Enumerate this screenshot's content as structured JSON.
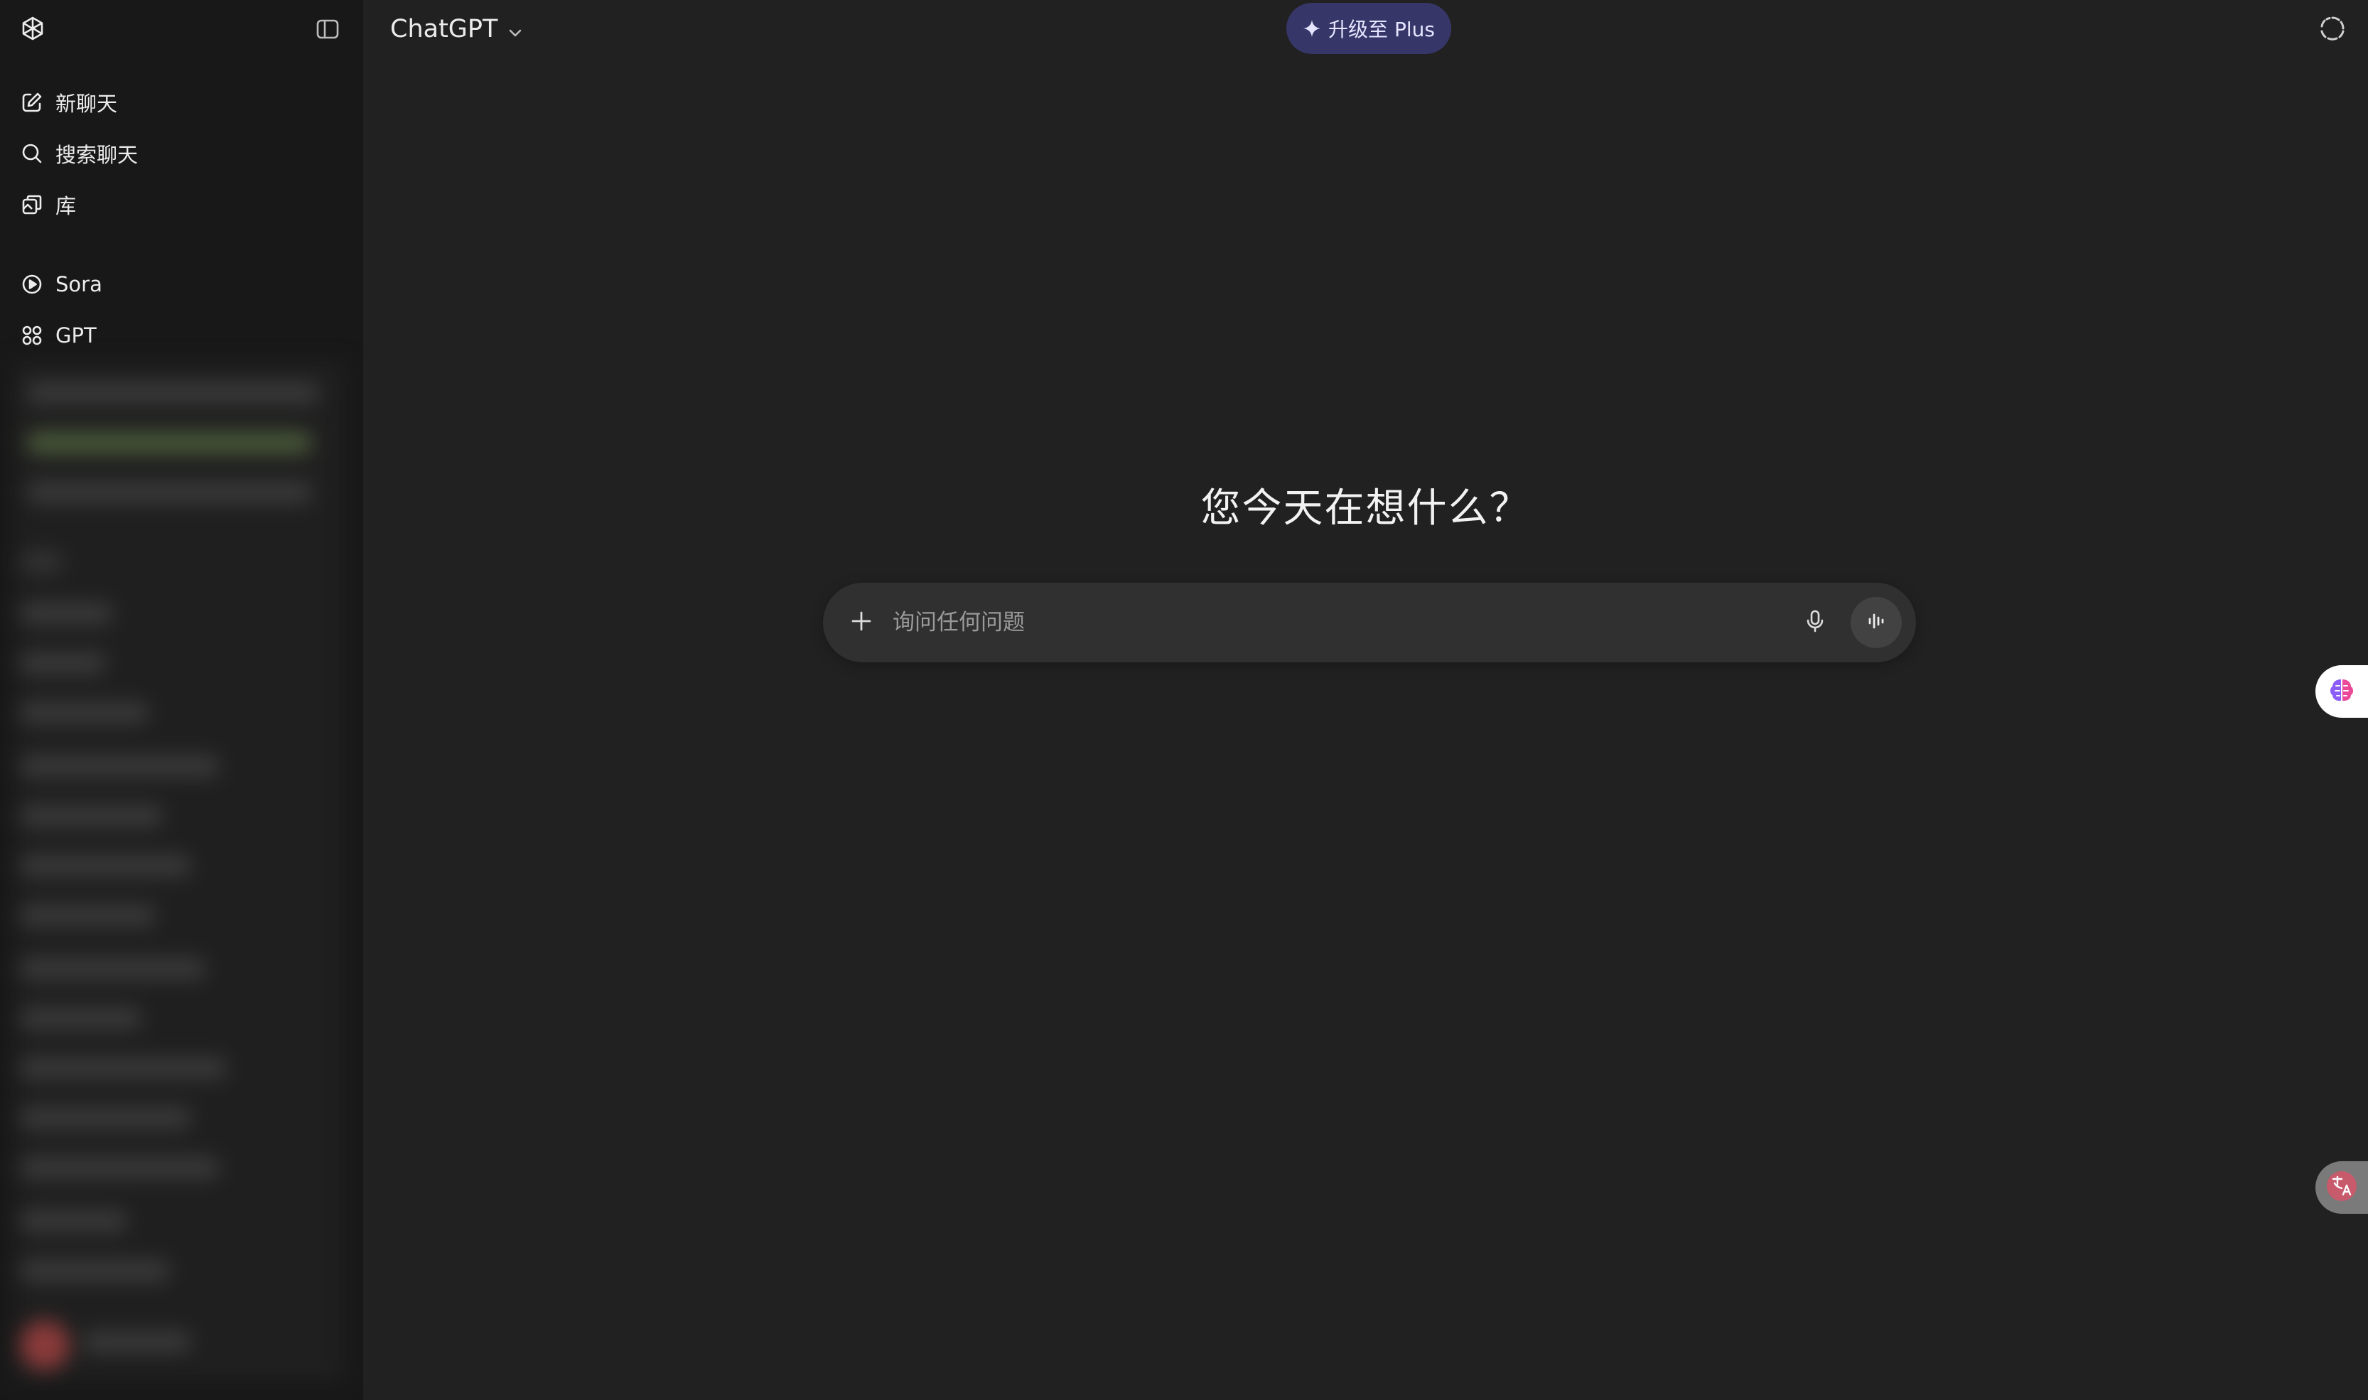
{
  "sidebar": {
    "items": [
      {
        "label": "新聊天",
        "icon": "edit-icon"
      },
      {
        "label": "搜索聊天",
        "icon": "search-icon"
      },
      {
        "label": "库",
        "icon": "library-icon"
      }
    ],
    "apps": [
      {
        "label": "Sora",
        "icon": "play-circle-icon"
      },
      {
        "label": "GPT",
        "icon": "grid-icon"
      }
    ]
  },
  "header": {
    "model_name": "ChatGPT",
    "upgrade_label": "升级至 Plus"
  },
  "main": {
    "headline": "您今天在想什么？",
    "composer_placeholder": "询问任何问题"
  },
  "colors": {
    "background": "#212121",
    "sidebar": "#181818",
    "upgrade_bg": "#373669",
    "composer_bg": "#303030"
  }
}
